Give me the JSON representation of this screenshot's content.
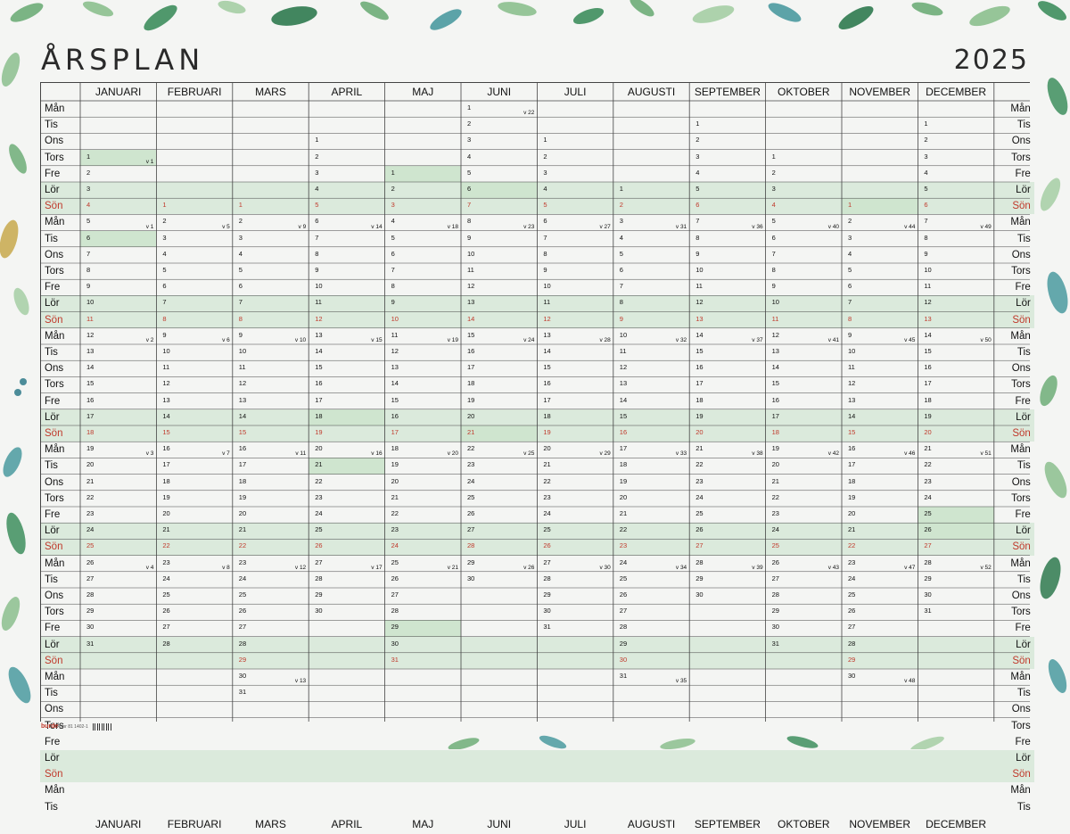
{
  "title": "ÅRSPLAN",
  "year": "2025",
  "months": [
    "JANUARI",
    "FEBRUARI",
    "MARS",
    "APRIL",
    "MAJ",
    "JUNI",
    "JULI",
    "AUGUSTI",
    "SEPTEMBER",
    "OKTOBER",
    "NOVEMBER",
    "DECEMBER"
  ],
  "weekday_labels": [
    "Mån",
    "Tis",
    "Ons",
    "Tors",
    "Fre",
    "Lör",
    "Sön"
  ],
  "month_days": [
    31,
    28,
    31,
    30,
    31,
    30,
    31,
    31,
    30,
    31,
    30,
    31
  ],
  "first_weekday": [
    3,
    6,
    6,
    2,
    4,
    0,
    2,
    5,
    1,
    3,
    6,
    1
  ],
  "grid_weeks": 6,
  "grid_tail_days": 2,
  "first_week_number": 1,
  "marked_days": {
    "JANUARI": [
      1,
      6
    ],
    "APRIL": [
      18,
      21
    ],
    "MAJ": [
      1,
      29
    ],
    "JUNI": [
      6,
      21
    ],
    "NOVEMBER": [
      1
    ],
    "DECEMBER": [
      25,
      26
    ]
  },
  "colors": {
    "weekend_band": "#dbeadc",
    "holiday": "#cfe5cf",
    "sunday_text": "#c0392b",
    "grid_line": "#444444"
  },
  "footer": {
    "brand": "burde",
    "code": "Artnr 81 1402-1",
    "barcode": "barcode-graphic"
  }
}
